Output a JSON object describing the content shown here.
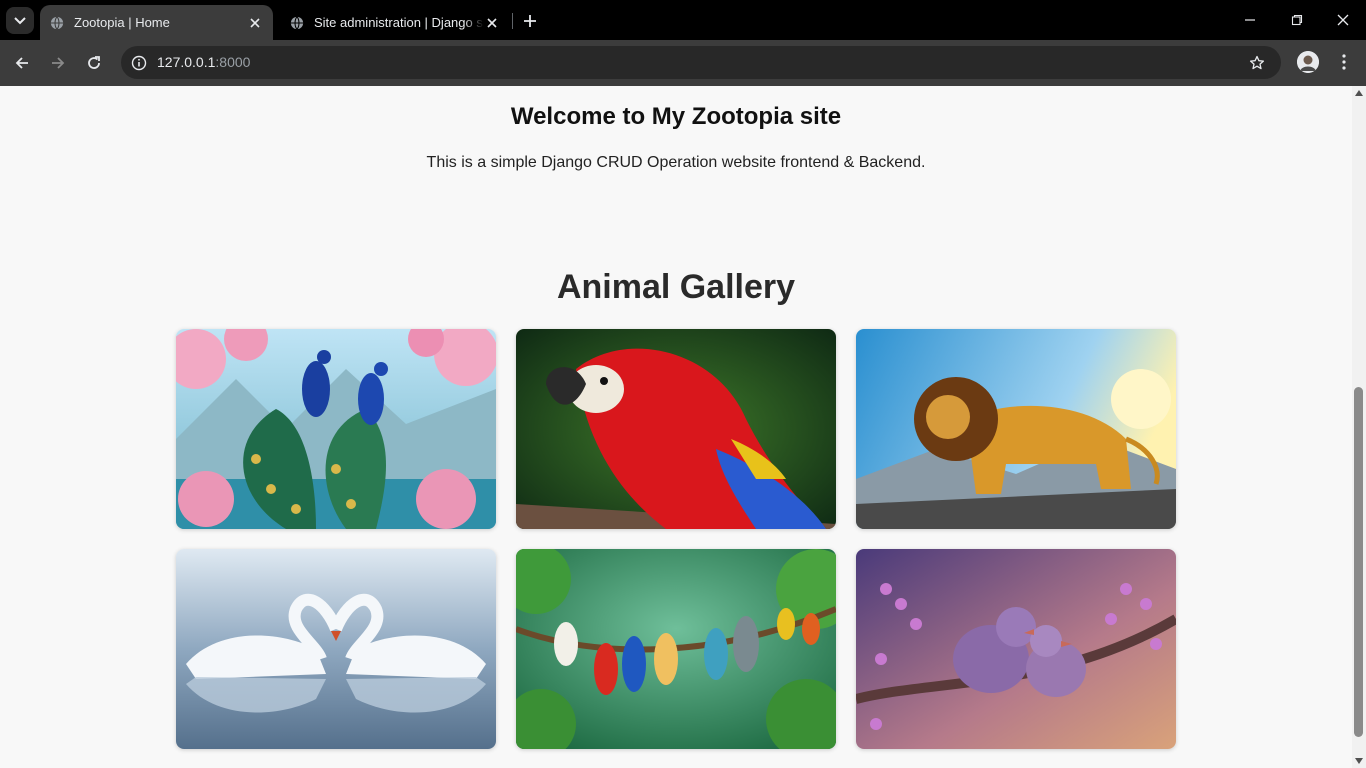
{
  "browser": {
    "tabs": [
      {
        "title": "Zootopia | Home",
        "active": true,
        "icon": "globe-icon"
      },
      {
        "title": "Site administration | Django site admin",
        "active": false,
        "icon": "globe-icon"
      }
    ],
    "address": {
      "host": "127.0.0.1",
      "port": ":8000"
    },
    "icons": [
      "tab-search-icon",
      "close-icon",
      "new-tab-icon",
      "minimize-icon",
      "restore-icon",
      "window-close-icon",
      "back-icon",
      "forward-icon",
      "reload-icon",
      "site-info-icon",
      "bookmark-star-icon",
      "profile-avatar",
      "kebab-menu-icon"
    ]
  },
  "page": {
    "welcome_title": "Welcome to My Zootopia site",
    "intro_text": "This is a simple Django CRUD Operation website frontend & Backend.",
    "gallery_title": "Animal Gallery",
    "gallery": [
      {
        "subject": "peacock-pair-image"
      },
      {
        "subject": "scarlet-macaw-image"
      },
      {
        "subject": "lion-image"
      },
      {
        "subject": "swans-heart-image"
      },
      {
        "subject": "parrots-on-branch-image"
      },
      {
        "subject": "lovebirds-image"
      }
    ]
  },
  "colors": {
    "chrome_bg": "#000000",
    "toolbar_bg": "#3c3c3c",
    "page_bg": "#f8f8f8"
  }
}
